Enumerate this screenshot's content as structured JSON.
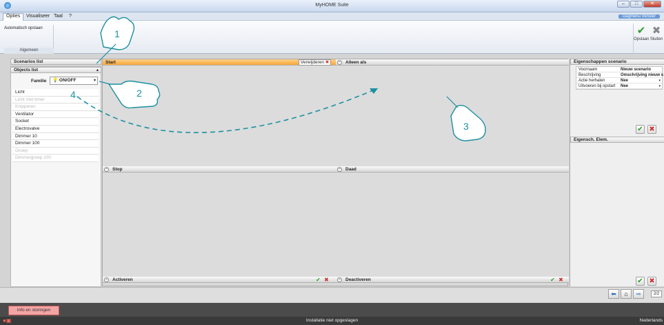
{
  "window": {
    "title": "MyHOME Suite",
    "controls": [
      "–",
      "□",
      "✕"
    ]
  },
  "menu": {
    "items": [
      "Opties",
      "Visualiseer",
      "Taal",
      "?"
    ],
    "right_label": "Dagmenu Venster"
  },
  "ribbon": {
    "group_option": "Automatisch opslaan",
    "group_label": "Algemeen",
    "save_label": "Opslaan",
    "close_label": "Sluiten"
  },
  "left": {
    "scenarios_header": "Scenarios list",
    "objects_header": "Objects list",
    "family_label": "Familie",
    "family_value": "ON/OFF",
    "objects": [
      {
        "label": "Licht",
        "enabled": true
      },
      {
        "label": "Licht met timer",
        "enabled": false
      },
      {
        "label": "Knipperen",
        "enabled": false
      },
      {
        "label": "Ventilator",
        "enabled": true
      },
      {
        "label": "Socket",
        "enabled": true
      },
      {
        "label": "Electrovalve",
        "enabled": true
      },
      {
        "label": "Dimmer 10",
        "enabled": true
      },
      {
        "label": "Dimmer 100",
        "enabled": true
      },
      {
        "label": "Groep",
        "enabled": false
      },
      {
        "label": "Dimmergroep 100",
        "enabled": false
      }
    ]
  },
  "center": {
    "start": "Start",
    "delete": "Verwijderen",
    "alleen_als": "Alleen als",
    "stop": "Stop",
    "daad": "Daad",
    "activeren": "Activeren",
    "deactiveren": "Deactiveren"
  },
  "right": {
    "props_header": "Eigenschappen scenario",
    "props": [
      {
        "label": "Voornaam",
        "value": "Nieuw scenario"
      },
      {
        "label": "Beschrijving",
        "value": "Omschrijving nieuw s"
      },
      {
        "label": "Actie herhalen",
        "value": "Nee"
      },
      {
        "label": "Uitvoeren bij opstart",
        "value": "Nee"
      }
    ],
    "elem_header": "Eigensch. Elem."
  },
  "nav": {
    "page": "2/2"
  },
  "info_tab": "Info en storingen",
  "status": {
    "text": "Installatie niet opgeslagen",
    "language": "Nederlands"
  },
  "callouts": [
    "1",
    "2",
    "3",
    "4"
  ],
  "colors": {
    "accent_orange": "#f7a838",
    "callout_teal": "#1b8fa0",
    "ok_green": "#2c9b2c",
    "cancel_red": "#cc3333"
  }
}
